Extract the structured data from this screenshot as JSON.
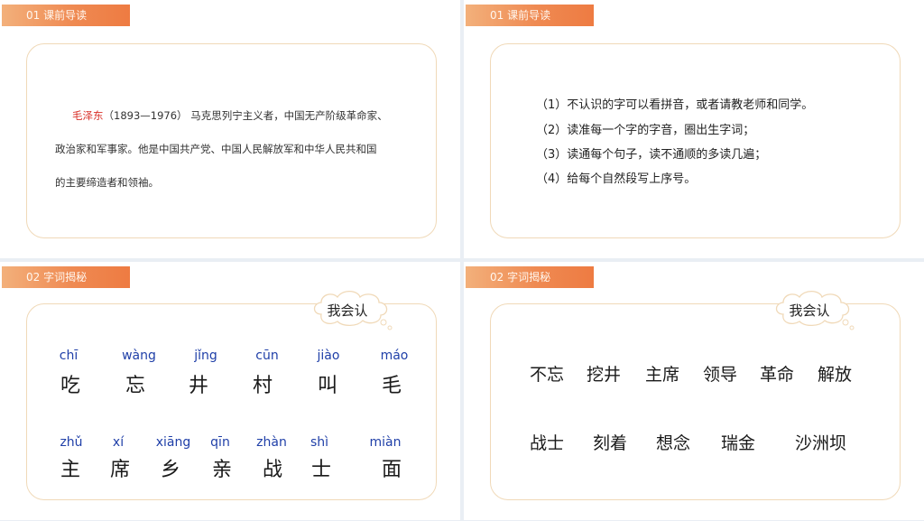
{
  "slide1": {
    "tag": "01  课前导读",
    "name": "毛泽东",
    "line1_rest": "（1893—1976） 马克思列宁主义者，中国无产阶级革命家、",
    "line2": "政治家和军事家。他是中国共产党、中国人民解放军和中华人民共和国",
    "line3": "的主要缔造者和领袖。"
  },
  "slide2": {
    "tag": "01  课前导读",
    "steps": [
      "（1）不认识的字可以看拼音，或者请教老师和同学。",
      "（2）读准每一个字的字音，圈出生字词；",
      "（3）读通每个句子，读不通顺的多读几遍；",
      "（4）给每个自然段写上序号。"
    ]
  },
  "slide3": {
    "tag": "02  字词揭秘",
    "cloud": "我会认",
    "row1": [
      {
        "py": "chī",
        "hz": "吃"
      },
      {
        "py": "wàng",
        "hz": "忘"
      },
      {
        "py": "jǐng",
        "hz": "井"
      },
      {
        "py": "cūn",
        "hz": "村"
      },
      {
        "py": "jiào",
        "hz": "叫"
      },
      {
        "py": "máo",
        "hz": "毛"
      }
    ],
    "row2": [
      {
        "py": "zhǔ",
        "hz": "主"
      },
      {
        "py": "xí",
        "hz": "席"
      },
      {
        "py": "xiāng",
        "hz": "乡"
      },
      {
        "py": "qīn",
        "hz": "亲"
      },
      {
        "py": "zhàn",
        "hz": "战"
      },
      {
        "py": "shì",
        "hz": "士"
      },
      {
        "py": "miàn",
        "hz": "面"
      }
    ]
  },
  "slide4": {
    "tag": "02  字词揭秘",
    "cloud": "我会认",
    "row1": [
      "不忘",
      "挖井",
      "主席",
      "领导",
      "革命",
      "解放"
    ],
    "row2": [
      "战士",
      "刻着",
      "想念",
      "瑞金",
      "沙洲坝"
    ]
  }
}
